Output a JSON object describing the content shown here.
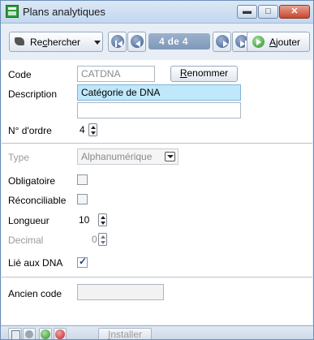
{
  "window": {
    "title": "Plans analytiques",
    "minimize_glyph": "▬",
    "maximize_glyph": "□",
    "close_glyph": "✕"
  },
  "toolbar": {
    "search_label": "Rechercher",
    "record_position": "4 de 4",
    "add_label": "Ajouter"
  },
  "form": {
    "code_label": "Code",
    "code_value": "CATDNA",
    "rename_label": "Renommer",
    "description_label": "Description",
    "description_value": "Catégorie de DNA",
    "description2_value": "",
    "order_label": "N° d'ordre",
    "order_value": "4",
    "type_label": "Type",
    "type_value": "Alphanumérique",
    "mandatory_label": "Obligatoire",
    "mandatory_checked": false,
    "reconcilable_label": "Réconciliable",
    "reconcilable_checked": false,
    "length_label": "Longueur",
    "length_value": "10",
    "decimal_label": "Decimal",
    "decimal_value": "0",
    "linked_label": "Lié aux DNA",
    "linked_checked": true,
    "old_code_label": "Ancien code",
    "old_code_value": ""
  },
  "statusbar": {
    "install_label": "Installer"
  },
  "colors": {
    "title_bar": "#c3d7ee",
    "highlight_field": "#bfe8fb",
    "accent_green": "#2a8a2b",
    "accent_red": "#c02020"
  }
}
